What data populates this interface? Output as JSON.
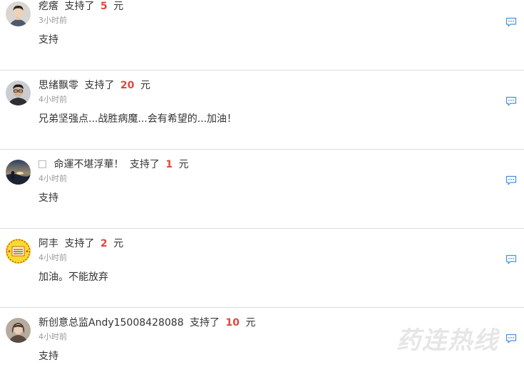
{
  "comments": [
    {
      "name": "疙瘩",
      "action": "支持了",
      "amount": "5",
      "unit": "元",
      "time": "3小时前",
      "message": "支持",
      "avatar_icon": "avatar-young-man-icon"
    },
    {
      "name": "思绪飘零",
      "action": "支持了",
      "amount": "20",
      "unit": "元",
      "time": "4小时前",
      "message": "兄弟坚强点...战胜病魔...会有希望的...加油！",
      "avatar_icon": "avatar-man-glasses-icon"
    },
    {
      "name": "命運不堪浮華！",
      "action": "支持了",
      "amount": "1",
      "unit": "元",
      "time": "4小时前",
      "message": "支持",
      "avatar_icon": "avatar-sunset-icon"
    },
    {
      "name": "阿丰",
      "action": "支持了",
      "amount": "2",
      "unit": "元",
      "time": "4小时前",
      "message": "加油。不能放弃",
      "avatar_icon": "avatar-yellow-badge-icon"
    },
    {
      "name": "新创意总监Andy15008428088",
      "action": "支持了",
      "amount": "10",
      "unit": "元",
      "time": "4小时前",
      "message": "支持",
      "avatar_icon": "avatar-woman-icon"
    }
  ],
  "watermark": "药连热线",
  "colors": {
    "amount": "#e2473b",
    "reply_icon": "#4a90d9",
    "divider": "#dcdcdc",
    "muted_text": "#999999"
  }
}
